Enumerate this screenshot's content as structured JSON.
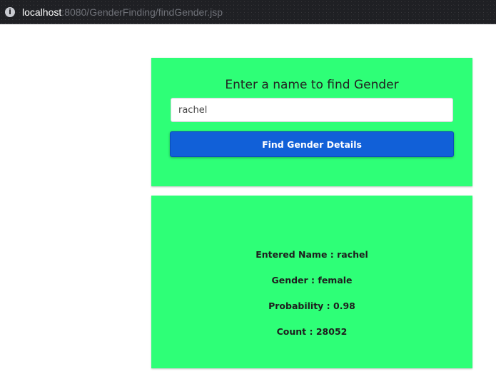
{
  "browser": {
    "url_host": "localhost",
    "url_rest": ":8080/GenderFinding/findGender.jsp",
    "info_icon": "info-icon"
  },
  "form": {
    "title": "Enter a name to find Gender",
    "name_value": "rachel",
    "button_label": "Find Gender Details"
  },
  "result": {
    "entered_name": "Entered Name : rachel",
    "gender": "Gender : female",
    "probability": "Probability : 0.98",
    "count": "Count : 28052"
  },
  "colors": {
    "card_background": "#2eff77",
    "button_background": "#1160d8",
    "browser_bar": "#1f2024"
  }
}
